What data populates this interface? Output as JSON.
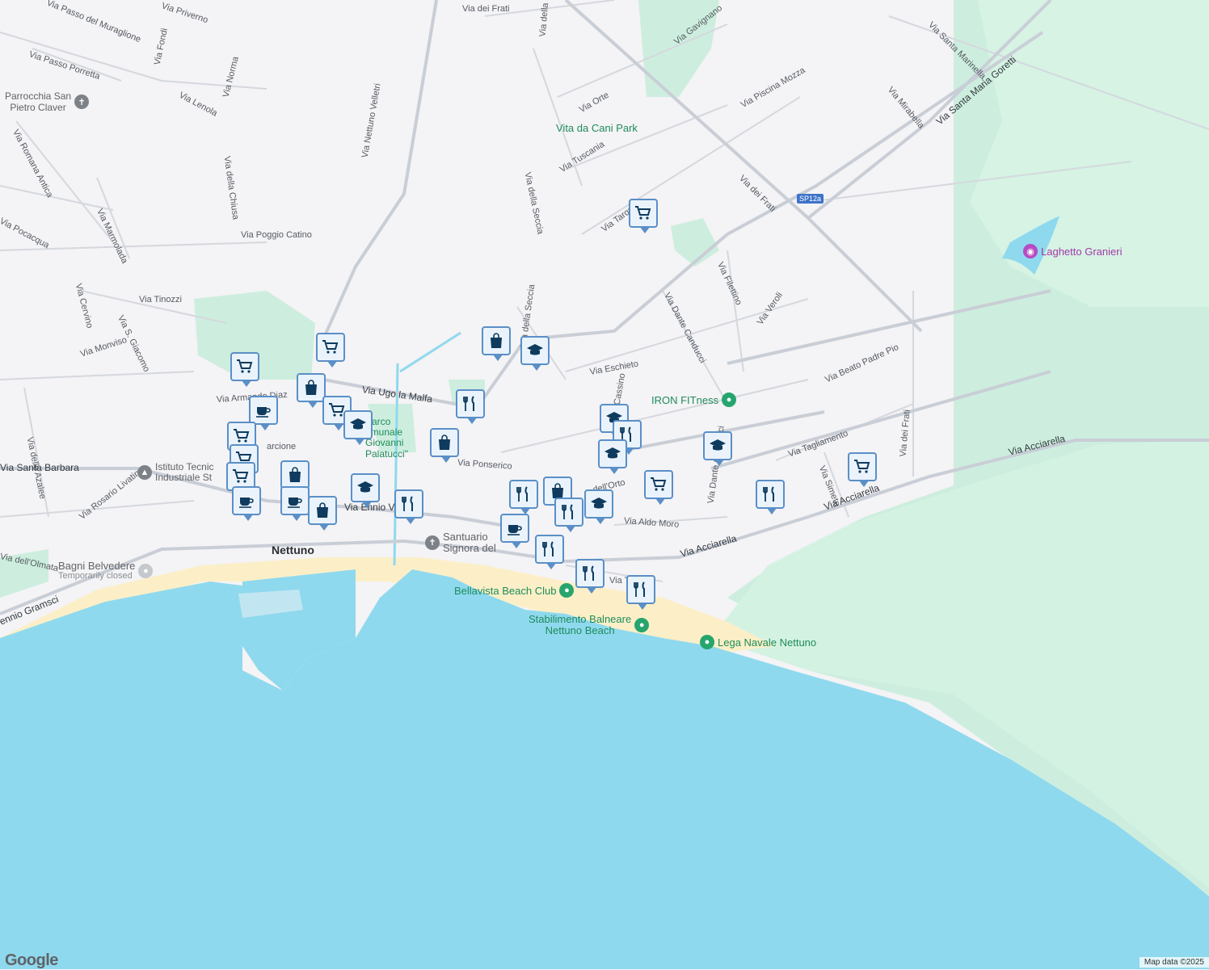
{
  "map": {
    "attribution": "Map data ©2025",
    "logo": "Google",
    "colors": {
      "land": "#f4f3f5",
      "water": "#8fd9ee",
      "park": "#cdeede",
      "road": "#c9ced6",
      "marker": "#5a8fc7",
      "poi_green": "#26a56e"
    }
  },
  "streets": [
    {
      "name": "Via dei Frati"
    },
    {
      "name": "Via Passo del Muraglione"
    },
    {
      "name": "Via Priverno"
    },
    {
      "name": "Via Fondi"
    },
    {
      "name": "Via Passo Porretta"
    },
    {
      "name": "Via Norma"
    },
    {
      "name": "Via Lenola"
    },
    {
      "name": "Via Romana Antica"
    },
    {
      "name": "Via della Chiusa"
    },
    {
      "name": "Via Nettuno Velletri"
    },
    {
      "name": "Via della Seccia"
    },
    {
      "name": "Via Gavignano"
    },
    {
      "name": "Via Santa Marinella"
    },
    {
      "name": "Via Mirabella"
    },
    {
      "name": "Via Piscina Mozza"
    },
    {
      "name": "Via Orte"
    },
    {
      "name": "Via Santa Maria Goretti"
    },
    {
      "name": "Via Tuscania"
    },
    {
      "name": "Via della Seccia"
    },
    {
      "name": "Via dei Frati"
    },
    {
      "name": "Via Tarquinia"
    },
    {
      "name": "Via Pocacqua"
    },
    {
      "name": "Via Marmolada"
    },
    {
      "name": "Via Poggio Catino"
    },
    {
      "name": "Via Filettino"
    },
    {
      "name": "Via Dante Canducci"
    },
    {
      "name": "Via Veroli"
    },
    {
      "name": "Via Cervino"
    },
    {
      "name": "Via Tinozzi"
    },
    {
      "name": "Via S. Giacomo"
    },
    {
      "name": "Via Monviso"
    },
    {
      "name": "Via della Seccia"
    },
    {
      "name": "Via Eschieto"
    },
    {
      "name": "Via Beato Padre Pio"
    },
    {
      "name": "Via Ugo la Malfa"
    },
    {
      "name": "Via Armando Diaz"
    },
    {
      "name": "Via delle Azalee"
    },
    {
      "name": "Cassino"
    },
    {
      "name": "Via Tagliamento"
    },
    {
      "name": "Via Acciarella"
    },
    {
      "name": "Via Santa Barbara"
    },
    {
      "name": "Via Ponserico"
    },
    {
      "name": "Via Simeto"
    },
    {
      "name": "Via dei Frati"
    },
    {
      "name": "Via Dante Canducci"
    },
    {
      "name": "Via Rosario Livatino"
    },
    {
      "name": "Via Ennio V"
    },
    {
      "name": "Via Aldo Moro"
    },
    {
      "name": "Via dell'Olmata"
    },
    {
      "name": "Via Acciarella"
    },
    {
      "name": "Via Acciarella"
    },
    {
      "name": "Via Trau"
    },
    {
      "name": "ennio Gramsci"
    },
    {
      "name": "SP12a"
    },
    {
      "name": "arcione"
    },
    {
      "name": "dell'Orto"
    }
  ],
  "places": [
    {
      "name": "Nettuno",
      "sub": ""
    },
    {
      "name": "Parrocchia San",
      "sub": "Pietro Claver"
    },
    {
      "name": "Vita da Cani Park",
      "sub": ""
    },
    {
      "name": "Laghetto Granieri",
      "sub": ""
    },
    {
      "name": "IRON FITness",
      "sub": ""
    },
    {
      "name": "Parco",
      "sub": "omunale Giovanni Palatucci\""
    },
    {
      "name": "Istituto Tecnic",
      "sub": "Industriale St"
    },
    {
      "name": "Santuario",
      "sub": "Signora del"
    },
    {
      "name": "Bagni Belvedere",
      "sub": "Temporarily closed"
    },
    {
      "name": "Bellavista Beach Club",
      "sub": ""
    },
    {
      "name": "Stabilimento Balneare",
      "sub": "Nettuno Beach"
    },
    {
      "name": "Lega Navale Nettuno",
      "sub": ""
    }
  ]
}
